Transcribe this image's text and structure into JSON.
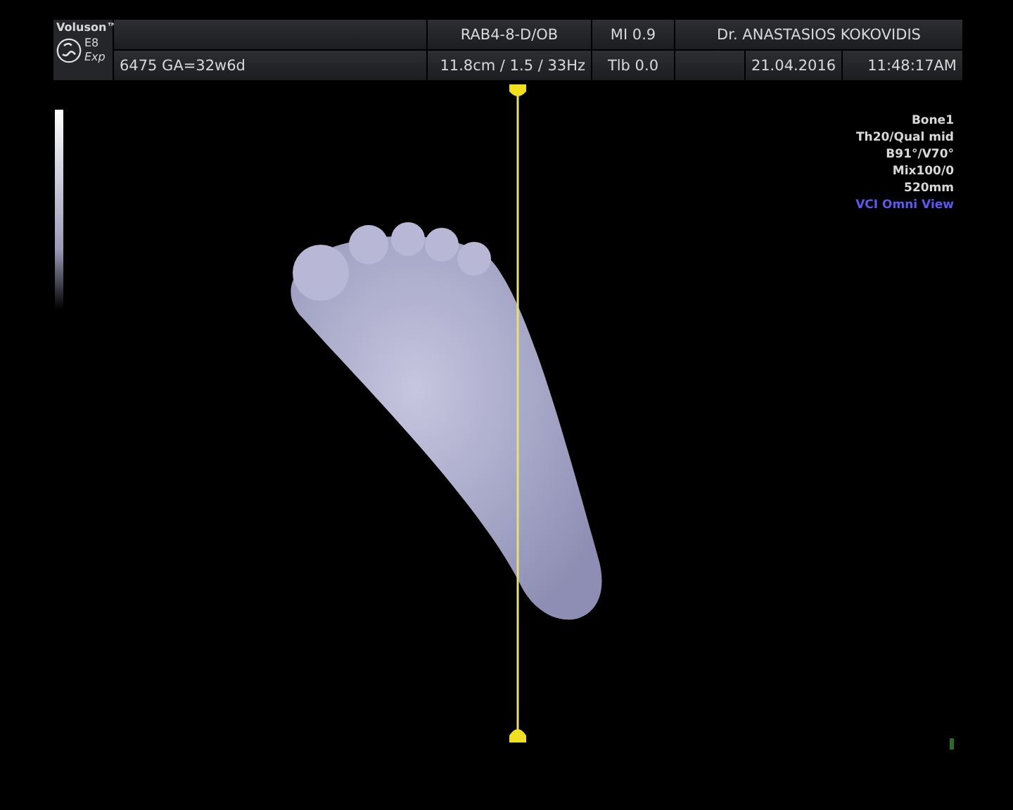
{
  "header": {
    "brand": "Voluson™",
    "model": "E8",
    "edition": "Exp",
    "patient": "6475  GA=32w6d",
    "probe": "RAB4-8-D/OB",
    "depth": "11.8cm / 1.5 / 33Hz",
    "mi": "MI  0.9",
    "tib": "Tlb  0.0",
    "operator": "Dr. ANASTASIOS KOKOVIDIS",
    "date": "21.04.2016",
    "time": "11:48:17AM"
  },
  "info": [
    {
      "text": "Bone1",
      "color": "#d8d8d8"
    },
    {
      "text": "Th20/Qual mid",
      "color": "#d8d8d8"
    },
    {
      "text": "B91°/V70°",
      "color": "#d8d8d8"
    },
    {
      "text": "Mix100/0",
      "color": "#d8d8d8"
    },
    {
      "text": "520mm",
      "color": "#d8d8d8"
    },
    {
      "text": "VCI Omni View",
      "color": "#5a5af0"
    }
  ]
}
